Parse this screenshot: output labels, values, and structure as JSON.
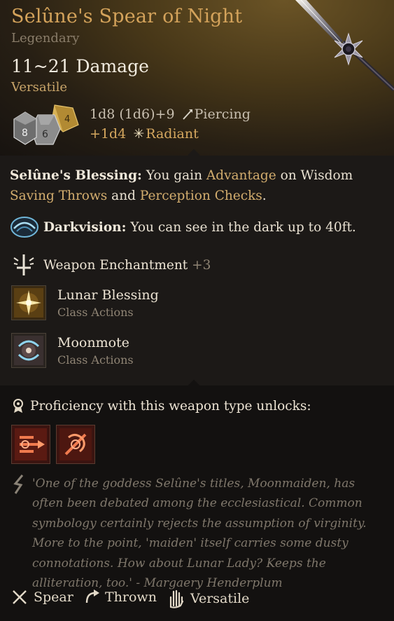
{
  "item": {
    "name": "Selûne's Spear of Night",
    "rarity": "Legendary",
    "damage": "11~21 Damage",
    "property": "Versatile",
    "damage_line1_dice": "1d8 (1d6)+9",
    "damage_line1_type": "Piercing",
    "damage_line2_dice": "+1d4",
    "damage_line2_type": "Radiant",
    "dice_labels": [
      "8",
      "6",
      "4"
    ]
  },
  "blessing": {
    "name": "Selûne's Blessing:",
    "text_a": " You gain ",
    "advantage": "Advantage",
    "text_b": " on Wisdom",
    "saving_throws": "Saving Throws",
    "text_c": " and ",
    "perception": "Perception Checks",
    "text_d": "."
  },
  "darkvision": {
    "name": "Darkvision:",
    "text": " You can see in the dark up to 40ft."
  },
  "enchantment": {
    "label": "Weapon Enchantment",
    "value": "+3"
  },
  "actions": [
    {
      "title": "Lunar Blessing",
      "subtitle": "Class Actions",
      "icon": "lunar-blessing-icon"
    },
    {
      "title": "Moonmote",
      "subtitle": "Class Actions",
      "icon": "moonmote-icon"
    }
  ],
  "proficiency": {
    "label": "Proficiency with this weapon type unlocks:",
    "icons": [
      "weapon-action-1-icon",
      "weapon-action-2-icon"
    ]
  },
  "lore": "'One of the goddess Selûne's titles, Moonmaiden, has often been debated among the ecclesiastical. Common symbology certainly rejects the assumption of virginity. More to the point, 'maiden' itself carries some dusty connotations. How about Lunar Lady? Keeps the alliteration, too.' - Margaery Henderplum",
  "footer": [
    {
      "label": "Spear",
      "icon": "spear-icon"
    },
    {
      "label": "Thrown",
      "icon": "thrown-icon"
    },
    {
      "label": "Versatile",
      "icon": "versatile-hand-icon"
    }
  ],
  "colors": {
    "title": "#d4a35b",
    "highlight": "#d3ad6e",
    "radiant": "#d6a85f",
    "muted": "#8a7d6a",
    "lore": "#7f776b"
  }
}
